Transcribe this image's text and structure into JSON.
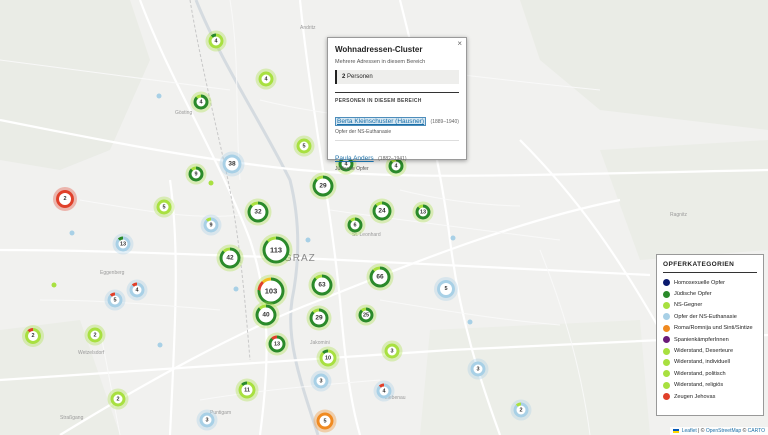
{
  "map": {
    "city_label": "GRAZ",
    "place_labels": [
      "Andritz",
      "St. Leonhard",
      "Ragnitz",
      "Jakomini",
      "Liebenau",
      "Gösting",
      "Eggenberg",
      "Wetzelsdorf",
      "Straßgang",
      "Puntigam"
    ],
    "clusters": [
      {
        "label": "4",
        "colors": [
          "#a8e040",
          "#2a8a2a"
        ],
        "fg": "#a8e040"
      },
      {
        "label": "4",
        "colors": [
          "#a8e040"
        ],
        "fg": "#a8e040"
      },
      {
        "label": "4",
        "colors": [
          "#2a8a2a",
          "#a8e040"
        ],
        "fg": "#a8e040"
      },
      {
        "label": "5",
        "colors": [
          "#a8e040"
        ],
        "fg": "#a8e040"
      },
      {
        "label": "38",
        "colors": [
          "#a8d0e6"
        ],
        "fg": "#a8d0e6"
      },
      {
        "label": "9",
        "colors": [
          "#2a8a2a",
          "#a8e040"
        ],
        "fg": "#a8e040"
      },
      {
        "label": "2",
        "colors": [
          "#e0402a"
        ],
        "fg": "#e0402a"
      },
      {
        "label": "5",
        "colors": [
          "#a8e040"
        ],
        "fg": "#a8e040"
      },
      {
        "label": "32",
        "colors": [
          "#2a8a2a",
          "#a8e040"
        ],
        "fg": "#a8e040"
      },
      {
        "label": "9",
        "colors": [
          "#a8d0e6",
          "#a8e040"
        ],
        "fg": "#a8d0e6"
      },
      {
        "label": "29",
        "colors": [
          "#2a8a2a",
          "#a8e040"
        ],
        "fg": "#a8e040"
      },
      {
        "label": "24",
        "colors": [
          "#2a8a2a",
          "#a8e040"
        ],
        "fg": "#a8e040"
      },
      {
        "label": "13",
        "colors": [
          "#2a8a2a",
          "#a8e040"
        ],
        "fg": "#a8e040"
      },
      {
        "label": "4",
        "colors": [
          "#2a8a2a",
          "#a8e040"
        ],
        "fg": "#a8e040"
      },
      {
        "label": "4",
        "colors": [
          "#2a8a2a",
          "#a8e040"
        ],
        "fg": "#a8e040"
      },
      {
        "label": "6",
        "colors": [
          "#2a8a2a",
          "#a8e040"
        ],
        "fg": "#a8e040"
      },
      {
        "label": "13",
        "colors": [
          "#a8d0e6",
          "#2a8a2a"
        ],
        "fg": "#a8d0e6"
      },
      {
        "label": "113",
        "colors": [
          "#2a8a2a",
          "#a8e040"
        ],
        "fg": "#a8e040"
      },
      {
        "label": "42",
        "colors": [
          "#2a8a2a",
          "#a8e040"
        ],
        "fg": "#a8e040"
      },
      {
        "label": "66",
        "colors": [
          "#2a8a2a",
          "#a8e040"
        ],
        "fg": "#a8e040"
      },
      {
        "label": "103",
        "colors": [
          "#2a8a2a",
          "#e0402a",
          "#f0c020"
        ],
        "fg": "#a8e040"
      },
      {
        "label": "63",
        "colors": [
          "#2a8a2a",
          "#a8e040"
        ],
        "fg": "#a8e040"
      },
      {
        "label": "40",
        "colors": [
          "#2a8a2a",
          "#a8e040"
        ],
        "fg": "#a8e040"
      },
      {
        "label": "29",
        "colors": [
          "#2a8a2a",
          "#a8e040"
        ],
        "fg": "#a8e040"
      },
      {
        "label": "25",
        "colors": [
          "#2a8a2a",
          "#a8e040"
        ],
        "fg": "#a8e040"
      },
      {
        "label": "5",
        "colors": [
          "#a8d0e6"
        ],
        "fg": "#a8d0e6"
      },
      {
        "label": "4",
        "colors": [
          "#a8d0e6",
          "#e0402a"
        ],
        "fg": "#a8d0e6"
      },
      {
        "label": "5",
        "colors": [
          "#a8d0e6",
          "#e0402a"
        ],
        "fg": "#a8d0e6"
      },
      {
        "label": "2",
        "colors": [
          "#a8e040",
          "#e0402a"
        ],
        "fg": "#a8e040"
      },
      {
        "label": "2",
        "colors": [
          "#a8e040"
        ],
        "fg": "#a8e040"
      },
      {
        "label": "13",
        "colors": [
          "#2a8a2a",
          "#e0402a"
        ],
        "fg": "#a8e040"
      },
      {
        "label": "3",
        "colors": [
          "#a8e040"
        ],
        "fg": "#a8e040"
      },
      {
        "label": "10",
        "colors": [
          "#a8e040",
          "#2a8a2a"
        ],
        "fg": "#a8e040"
      },
      {
        "label": "4",
        "colors": [
          "#a8d0e6",
          "#e0402a"
        ],
        "fg": "#a8d0e6"
      },
      {
        "label": "3",
        "colors": [
          "#a8d0e6"
        ],
        "fg": "#a8d0e6"
      },
      {
        "label": "2",
        "colors": [
          "#a8d0e6",
          "#a8e040"
        ],
        "fg": "#a8d0e6"
      },
      {
        "label": "11",
        "colors": [
          "#a8e040",
          "#2a8a2a"
        ],
        "fg": "#a8e040"
      },
      {
        "label": "2",
        "colors": [
          "#a8e040"
        ],
        "fg": "#a8e040"
      },
      {
        "label": "3",
        "colors": [
          "#a8d0e6"
        ],
        "fg": "#a8d0e6"
      },
      {
        "label": "3",
        "colors": [
          "#a8d0e6"
        ],
        "fg": "#a8d0e6"
      },
      {
        "label": "2",
        "colors": [
          "#a8e040"
        ],
        "fg": "#a8e040"
      },
      {
        "label": "5",
        "colors": [
          "#f08a20"
        ],
        "fg": "#f08a20"
      },
      {
        "label": "2",
        "colors": [
          "#a8d0e6",
          "#e0402a"
        ],
        "fg": "#a8d0e6"
      },
      {
        "label": "3",
        "colors": [
          "#a8d0e6"
        ],
        "fg": "#a8d0e6"
      },
      {
        "label": "3",
        "colors": [
          "#a8d0e6"
        ],
        "fg": "#a8d0e6"
      }
    ],
    "dot_colors": [
      "#a8d0e6",
      "#a8e040"
    ]
  },
  "popup": {
    "close": "×",
    "title": "Wohnadressen-Cluster",
    "subtitle": "Mehrere Adressen in diesem Bereich",
    "count_number": "2",
    "count_text": "Personen",
    "section_title": "PERSONEN IN DIESEM BEREICH",
    "persons": [
      {
        "name": "Berta Kleinschuster (Hausner)",
        "years": "(1889–1940)",
        "category": "Opfer der NS-Euthanasie"
      },
      {
        "name": "Paula Anders",
        "years": "(1882–1941)",
        "category": "Jüdische Opfer"
      }
    ]
  },
  "legend": {
    "title": "OPFERKATEGORIEN",
    "items": [
      {
        "label": "Homosexuelle Opfer",
        "color": "#0a1a6e"
      },
      {
        "label": "Jüdische Opfer",
        "color": "#2a8a2a"
      },
      {
        "label": "NS-Gegner",
        "color": "#a8e040"
      },
      {
        "label": "Opfer der NS-Euthanasie",
        "color": "#a8d0e6"
      },
      {
        "label": "Roma/Romnija und Sinti/Sintize",
        "color": "#f08a20"
      },
      {
        "label": "SpanienkämpferInnen",
        "color": "#6a1a7a"
      },
      {
        "label": "Widerstand, Deserteure",
        "color": "#a8e040"
      },
      {
        "label": "Widerstand, individuell",
        "color": "#a8e040"
      },
      {
        "label": "Widerstand, politisch",
        "color": "#a8e040"
      },
      {
        "label": "Widerstand, religiös",
        "color": "#a8e040"
      },
      {
        "label": "Zeugen Jehovas",
        "color": "#e0402a"
      }
    ]
  },
  "attribution": {
    "leaflet": "Leaflet",
    "sep1": " | © ",
    "osm": "OpenStreetMap",
    "sep2": " © ",
    "carto": "CARTO"
  }
}
